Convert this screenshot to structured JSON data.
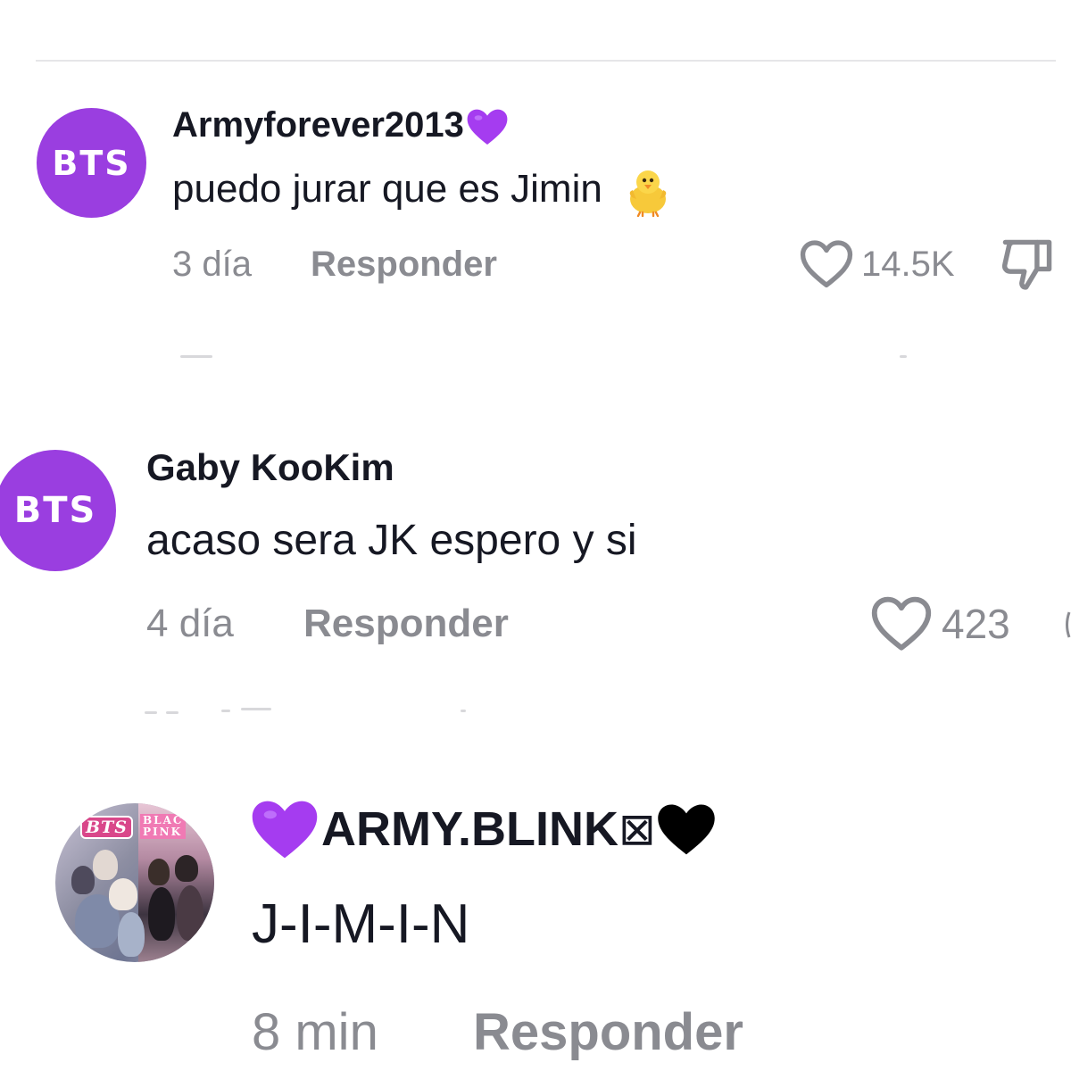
{
  "comments": [
    {
      "avatar_text": "BTS",
      "username": "Armyforever2013",
      "username_emoji": "purple-heart",
      "text": "puedo jurar que es Jimin",
      "text_emoji": "baby-chick",
      "time": "3 día",
      "reply_label": "Responder",
      "likes": "14.5K"
    },
    {
      "avatar_text": "BTS",
      "username": "Gaby KooKim",
      "text": "acaso sera JK espero y si",
      "time": "4 día",
      "reply_label": "Responder",
      "likes": "423"
    },
    {
      "avatar_bts_label": "BTS",
      "avatar_bp_label_1": "BLAC",
      "avatar_bp_label_2": "PINK",
      "username": "ARMY.BLINK",
      "username_prefix_emoji": "purple-heart",
      "username_suffix_glyph": "⊠",
      "username_suffix_emoji": "black-heart",
      "text": "J-I-M-I-N",
      "time": "8 min",
      "reply_label": "Responder"
    }
  ],
  "colors": {
    "avatar_purple": "#9a3ee0",
    "purple_heart": "#a53cf0",
    "black_heart": "#000000",
    "text_primary": "#161823",
    "text_secondary": "#8a8b91",
    "divider": "#e6e6e8"
  }
}
